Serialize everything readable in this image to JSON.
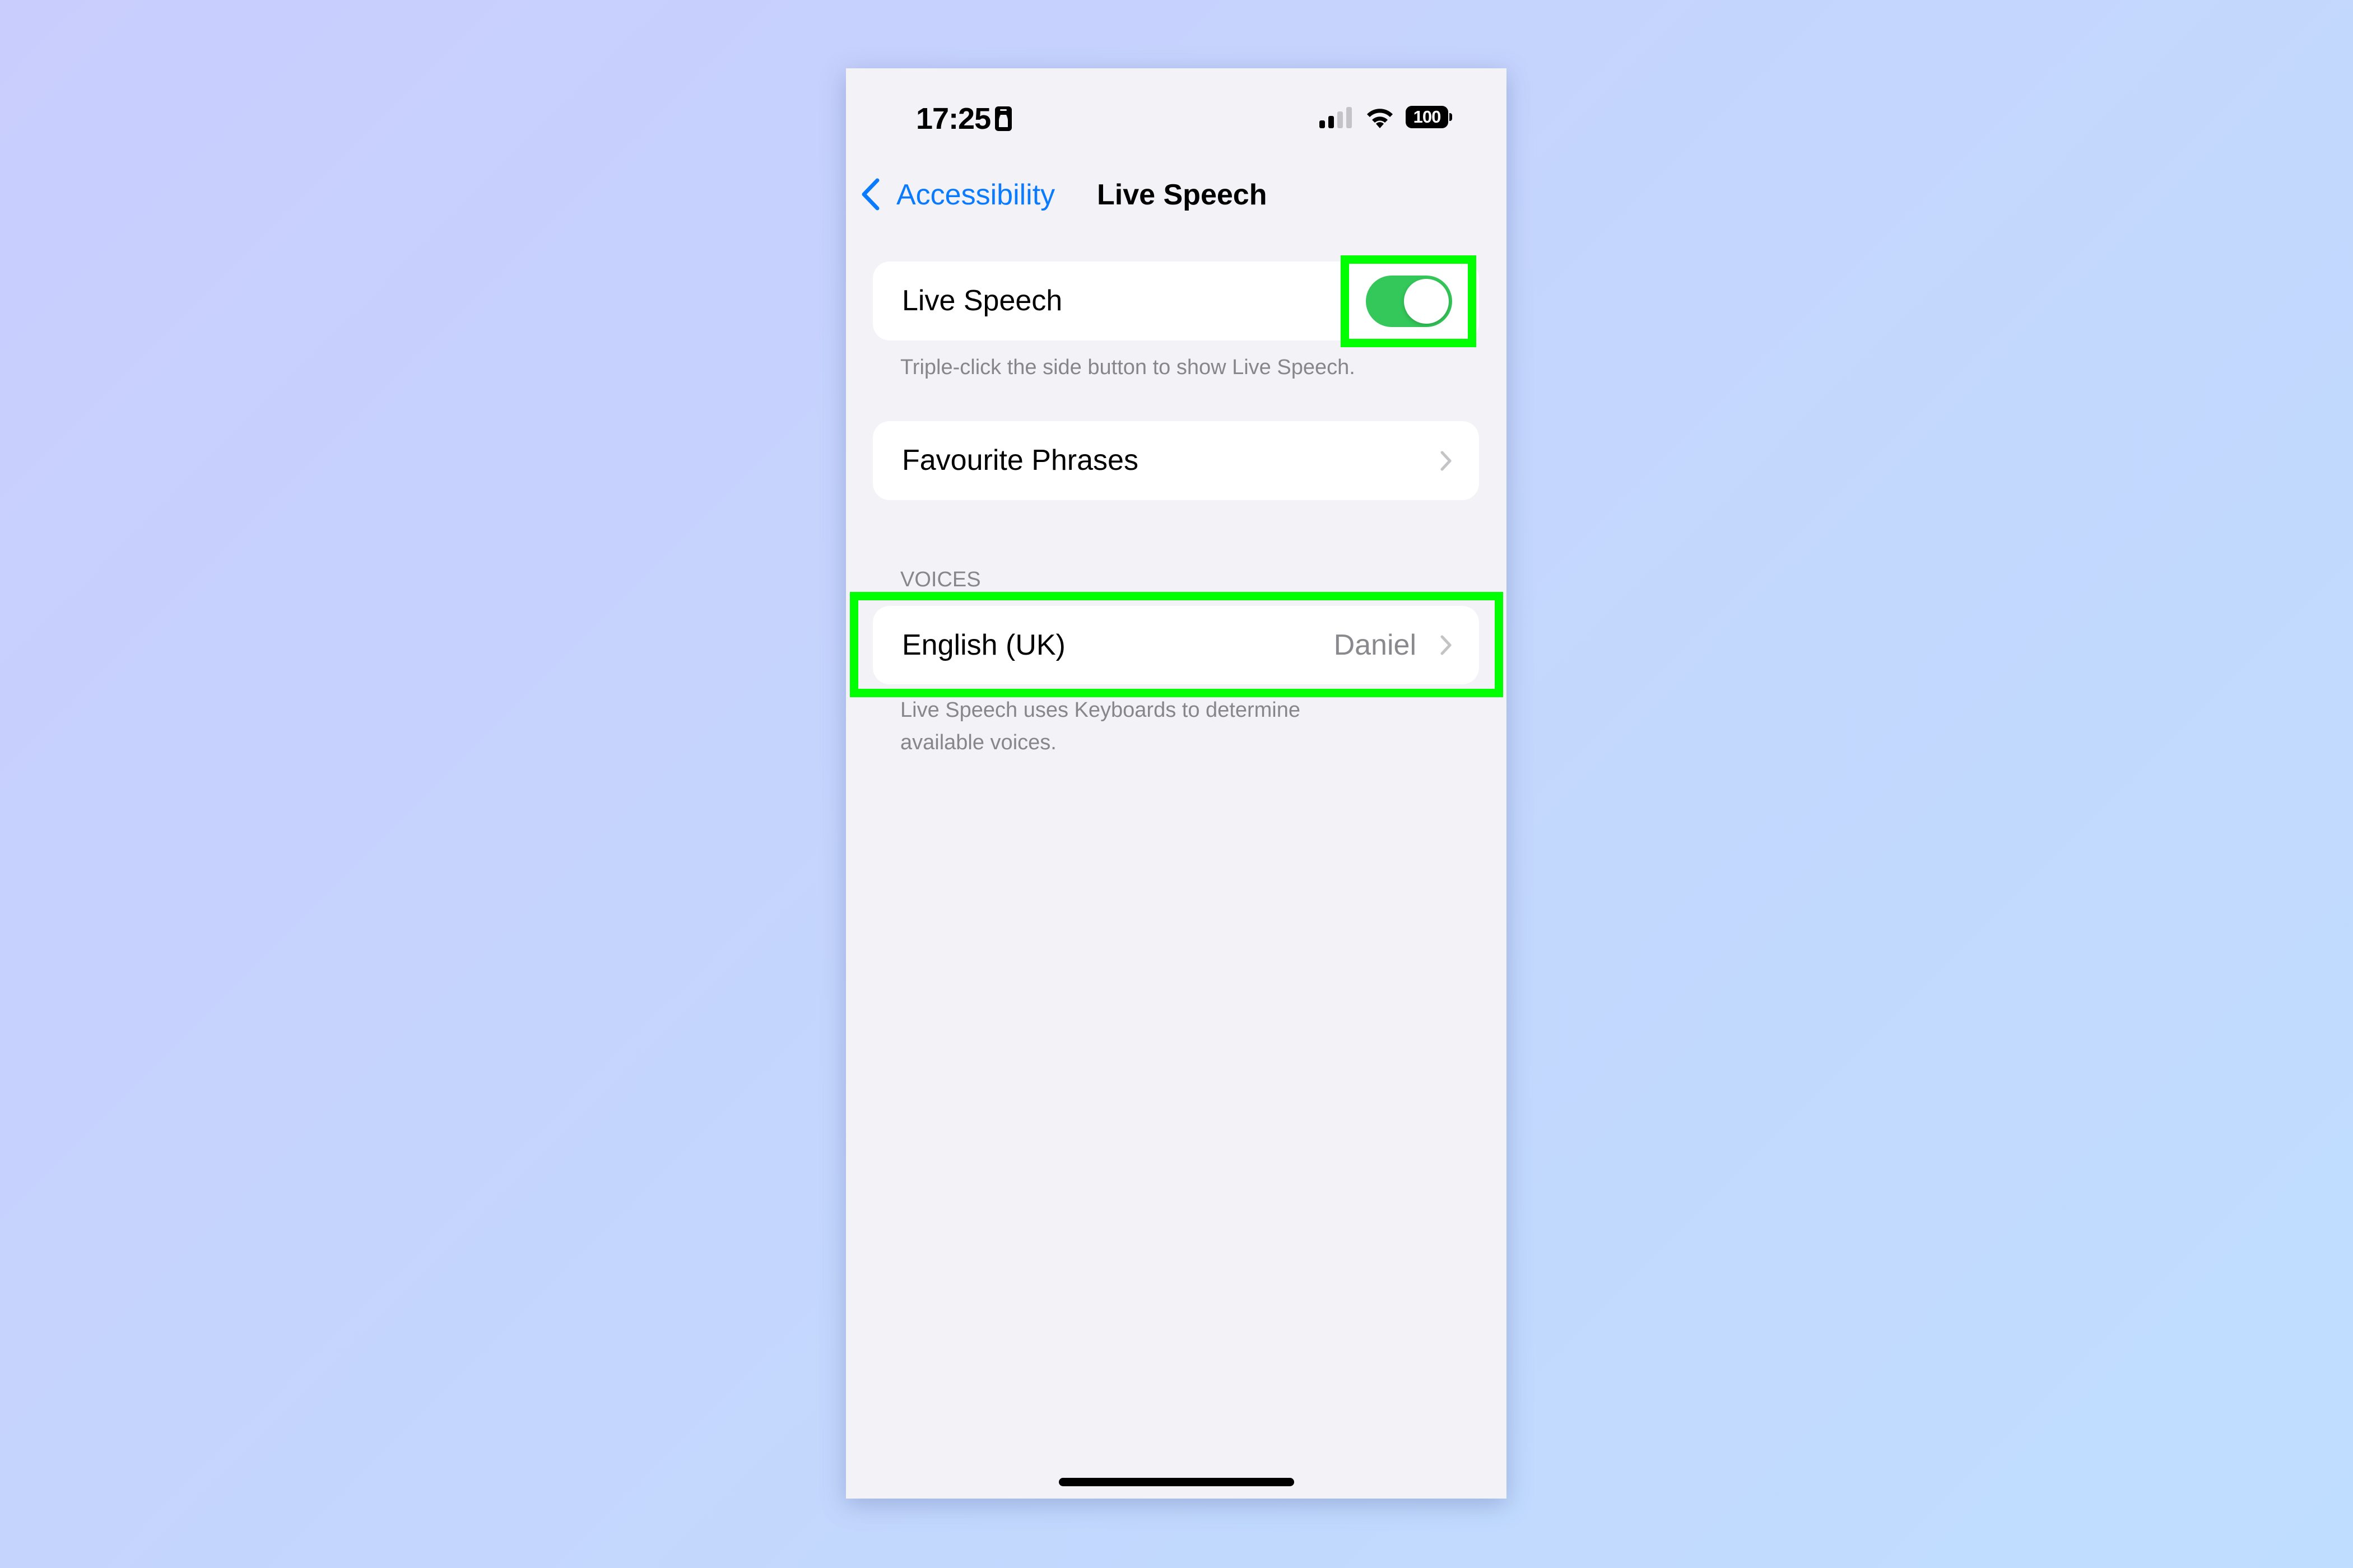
{
  "status_bar": {
    "time": "17:25",
    "focus_icon": "person-card-icon",
    "signal_bars_total": 4,
    "signal_bars_active": 2,
    "wifi_icon": "wifi-icon",
    "battery_level": "100"
  },
  "nav": {
    "back_label": "Accessibility",
    "back_icon": "chevron-left-icon",
    "title": "Live Speech"
  },
  "live_speech": {
    "label": "Live Speech",
    "toggle_on": true,
    "footer": "Triple-click the side button to show Live Speech."
  },
  "favourite_phrases": {
    "label": "Favourite Phrases",
    "icon": "chevron-right-icon"
  },
  "voices": {
    "header": "VOICES",
    "rows": [
      {
        "label": "English (UK)",
        "value": "Daniel",
        "icon": "chevron-right-icon"
      }
    ],
    "footer_line1": "Live Speech uses Keyboards to determine",
    "footer_line2": "available voices."
  },
  "annotations": {
    "highlight_color": "#00ff00",
    "highlighted": [
      "live-speech-toggle",
      "voice-row-english-uk"
    ]
  },
  "colors": {
    "accent": "#0a7aff",
    "toggle_on": "#34c759",
    "background": "#f2f2f7",
    "secondary_text": "#86868b"
  }
}
